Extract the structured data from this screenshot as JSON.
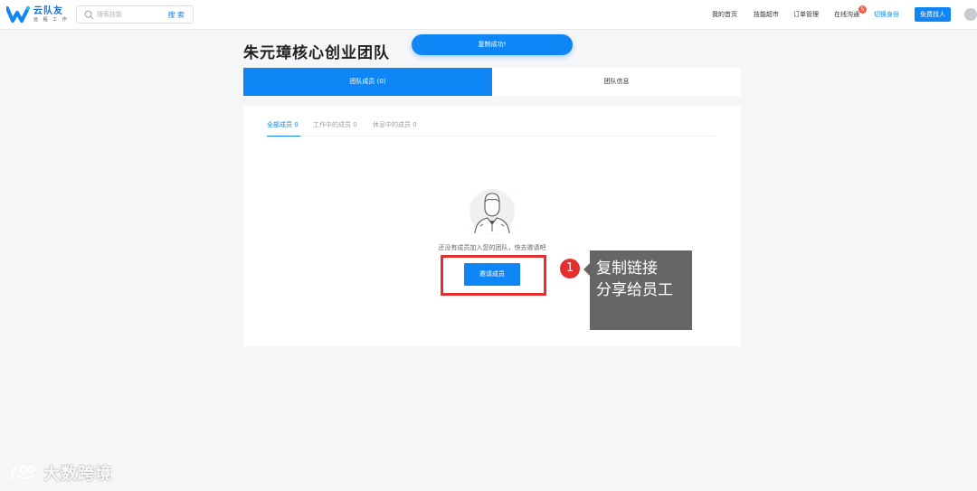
{
  "header": {
    "logo": {
      "name": "云队友",
      "sub": "远 程 工 作"
    },
    "search": {
      "placeholder": "搜索技能",
      "button": "搜 索"
    },
    "nav": {
      "home": "我的首页",
      "skills_market": "技能超市",
      "orders": "订单管理",
      "online_chat": "在线沟通",
      "online_chat_badge": "5",
      "switch_identity": "切换身份",
      "hire": "免费找人"
    }
  },
  "toast": {
    "message": "复制成功!"
  },
  "page": {
    "title": "朱元璋核心创业团队"
  },
  "tabs": [
    {
      "label": "团队成员 (0)"
    },
    {
      "label": "团队信息"
    }
  ],
  "subtabs": [
    {
      "label": "全部成员 0"
    },
    {
      "label": "工作中的成员 0"
    },
    {
      "label": "休息中的成员 0"
    }
  ],
  "empty": {
    "message": "还没有成员加入您的团队，快去邀请吧",
    "invite_button": "邀请成员"
  },
  "annotation": {
    "step": "1",
    "line1": "复制链接",
    "line2": "分享给员工"
  },
  "watermark": {
    "text": "大数跨境"
  },
  "colors": {
    "primary": "#0e86f5",
    "highlight": "#e52e2e",
    "callout": "#666666"
  }
}
